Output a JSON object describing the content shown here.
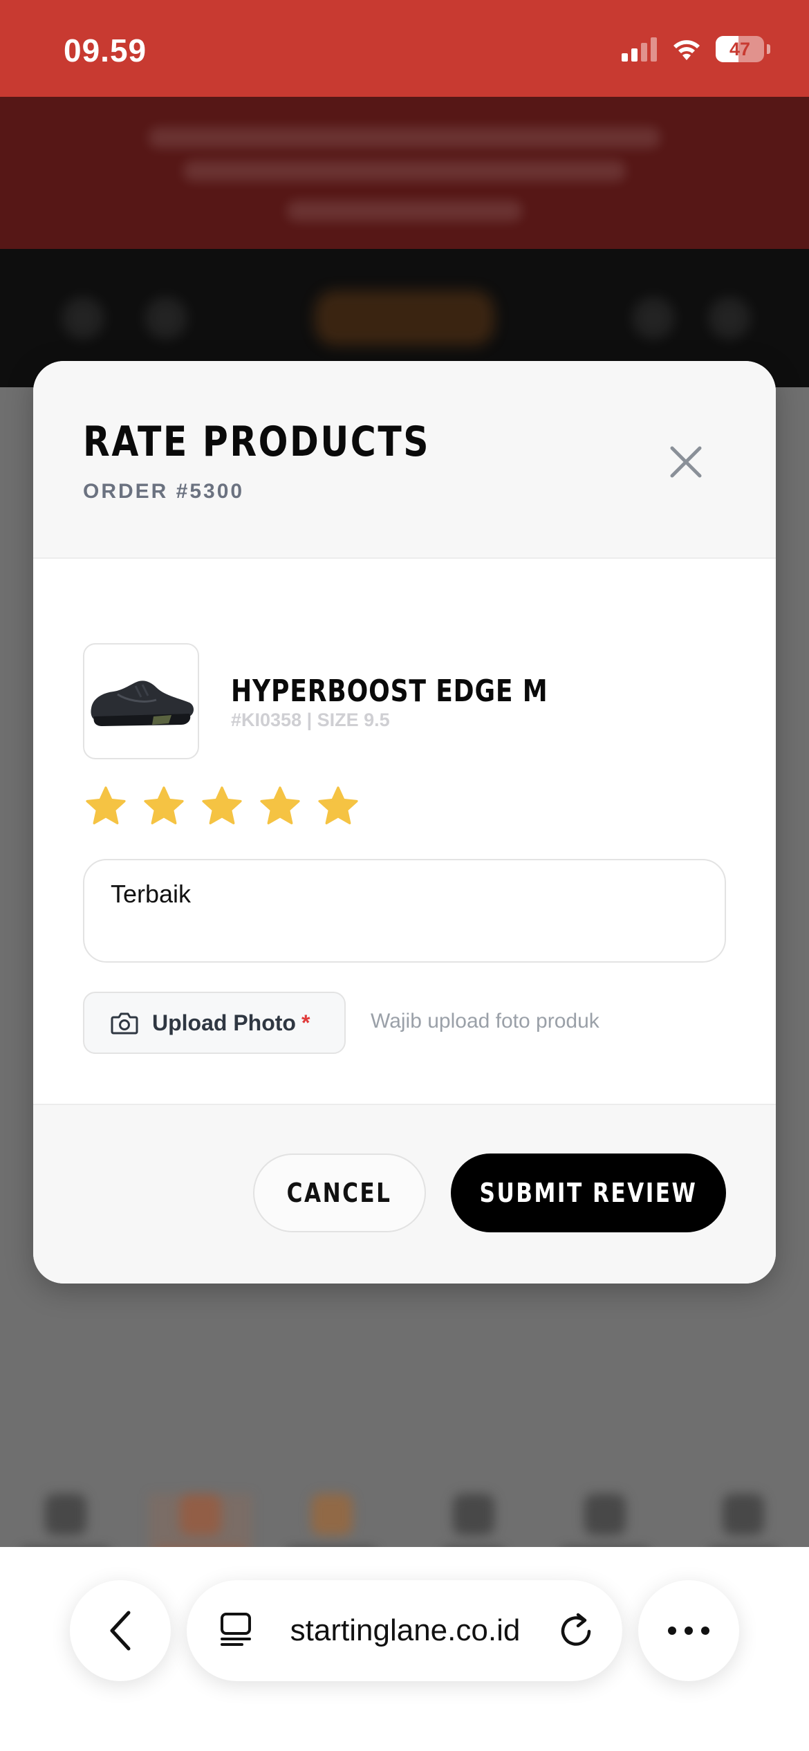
{
  "status_bar": {
    "time": "09.59",
    "battery_percent": "47",
    "battery_level": 0.47
  },
  "modal": {
    "title": "RATE PRODUCTS",
    "order_label": "ORDER #5300",
    "close_icon": "close-icon"
  },
  "product": {
    "name": "HYPERBOOST EDGE M",
    "sku_size": "#KI0358 | SIZE 9.5",
    "image_icon": "sneaker-image"
  },
  "rating": {
    "value": 5,
    "max": 5,
    "star_color": "#f5c343"
  },
  "review": {
    "value": "Terbaik"
  },
  "upload": {
    "label": "Upload Photo",
    "required_mark": "*",
    "hint": "Wajib upload foto produk",
    "icon": "camera-icon"
  },
  "actions": {
    "cancel_label": "CANCEL",
    "submit_label": "SUBMIT REVIEW"
  },
  "browser": {
    "url": "startinglane.co.id",
    "back_icon": "chevron-left-icon",
    "tabs_icon": "tab-layout-icon",
    "reload_icon": "reload-icon",
    "more_icon": "more-icon"
  },
  "colors": {
    "status_bar": "#c83a31",
    "accent_required": "#e03a3a",
    "primary_button": "#000000"
  }
}
